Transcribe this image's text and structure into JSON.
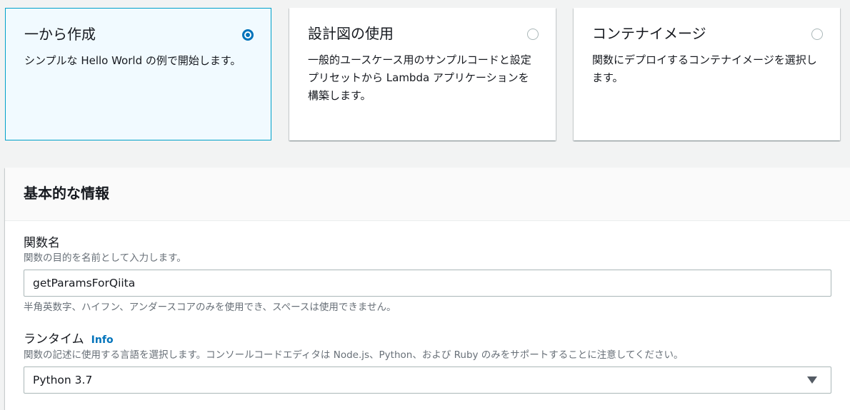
{
  "options": [
    {
      "title": "一から作成",
      "desc": "シンプルな Hello World の例で開始します。",
      "selected": true
    },
    {
      "title": "設計図の使用",
      "desc": "一般的ユースケース用のサンプルコードと設定プリセットから Lambda アプリケーションを構築します。",
      "selected": false
    },
    {
      "title": "コンテナイメージ",
      "desc": "関数にデプロイするコンテナイメージを選択します。",
      "selected": false
    }
  ],
  "basic_info": {
    "title": "基本的な情報",
    "function_name": {
      "label": "関数名",
      "description": "関数の目的を名前として入力します。",
      "value": "getParamsForQiita",
      "constraint": "半角英数字、ハイフン、アンダースコアのみを使用でき、スペースは使用できません。"
    },
    "runtime": {
      "label": "ランタイム",
      "info_link": "Info",
      "description": "関数の記述に使用する言語を選択します。コンソールコードエディタは Node.js、Python、および Ruby のみをサポートすることに注意してください。",
      "value": "Python 3.7"
    }
  },
  "colors": {
    "accent": "#0073bb",
    "selected_border": "#00a1c9",
    "selected_bg": "#f1faff"
  }
}
